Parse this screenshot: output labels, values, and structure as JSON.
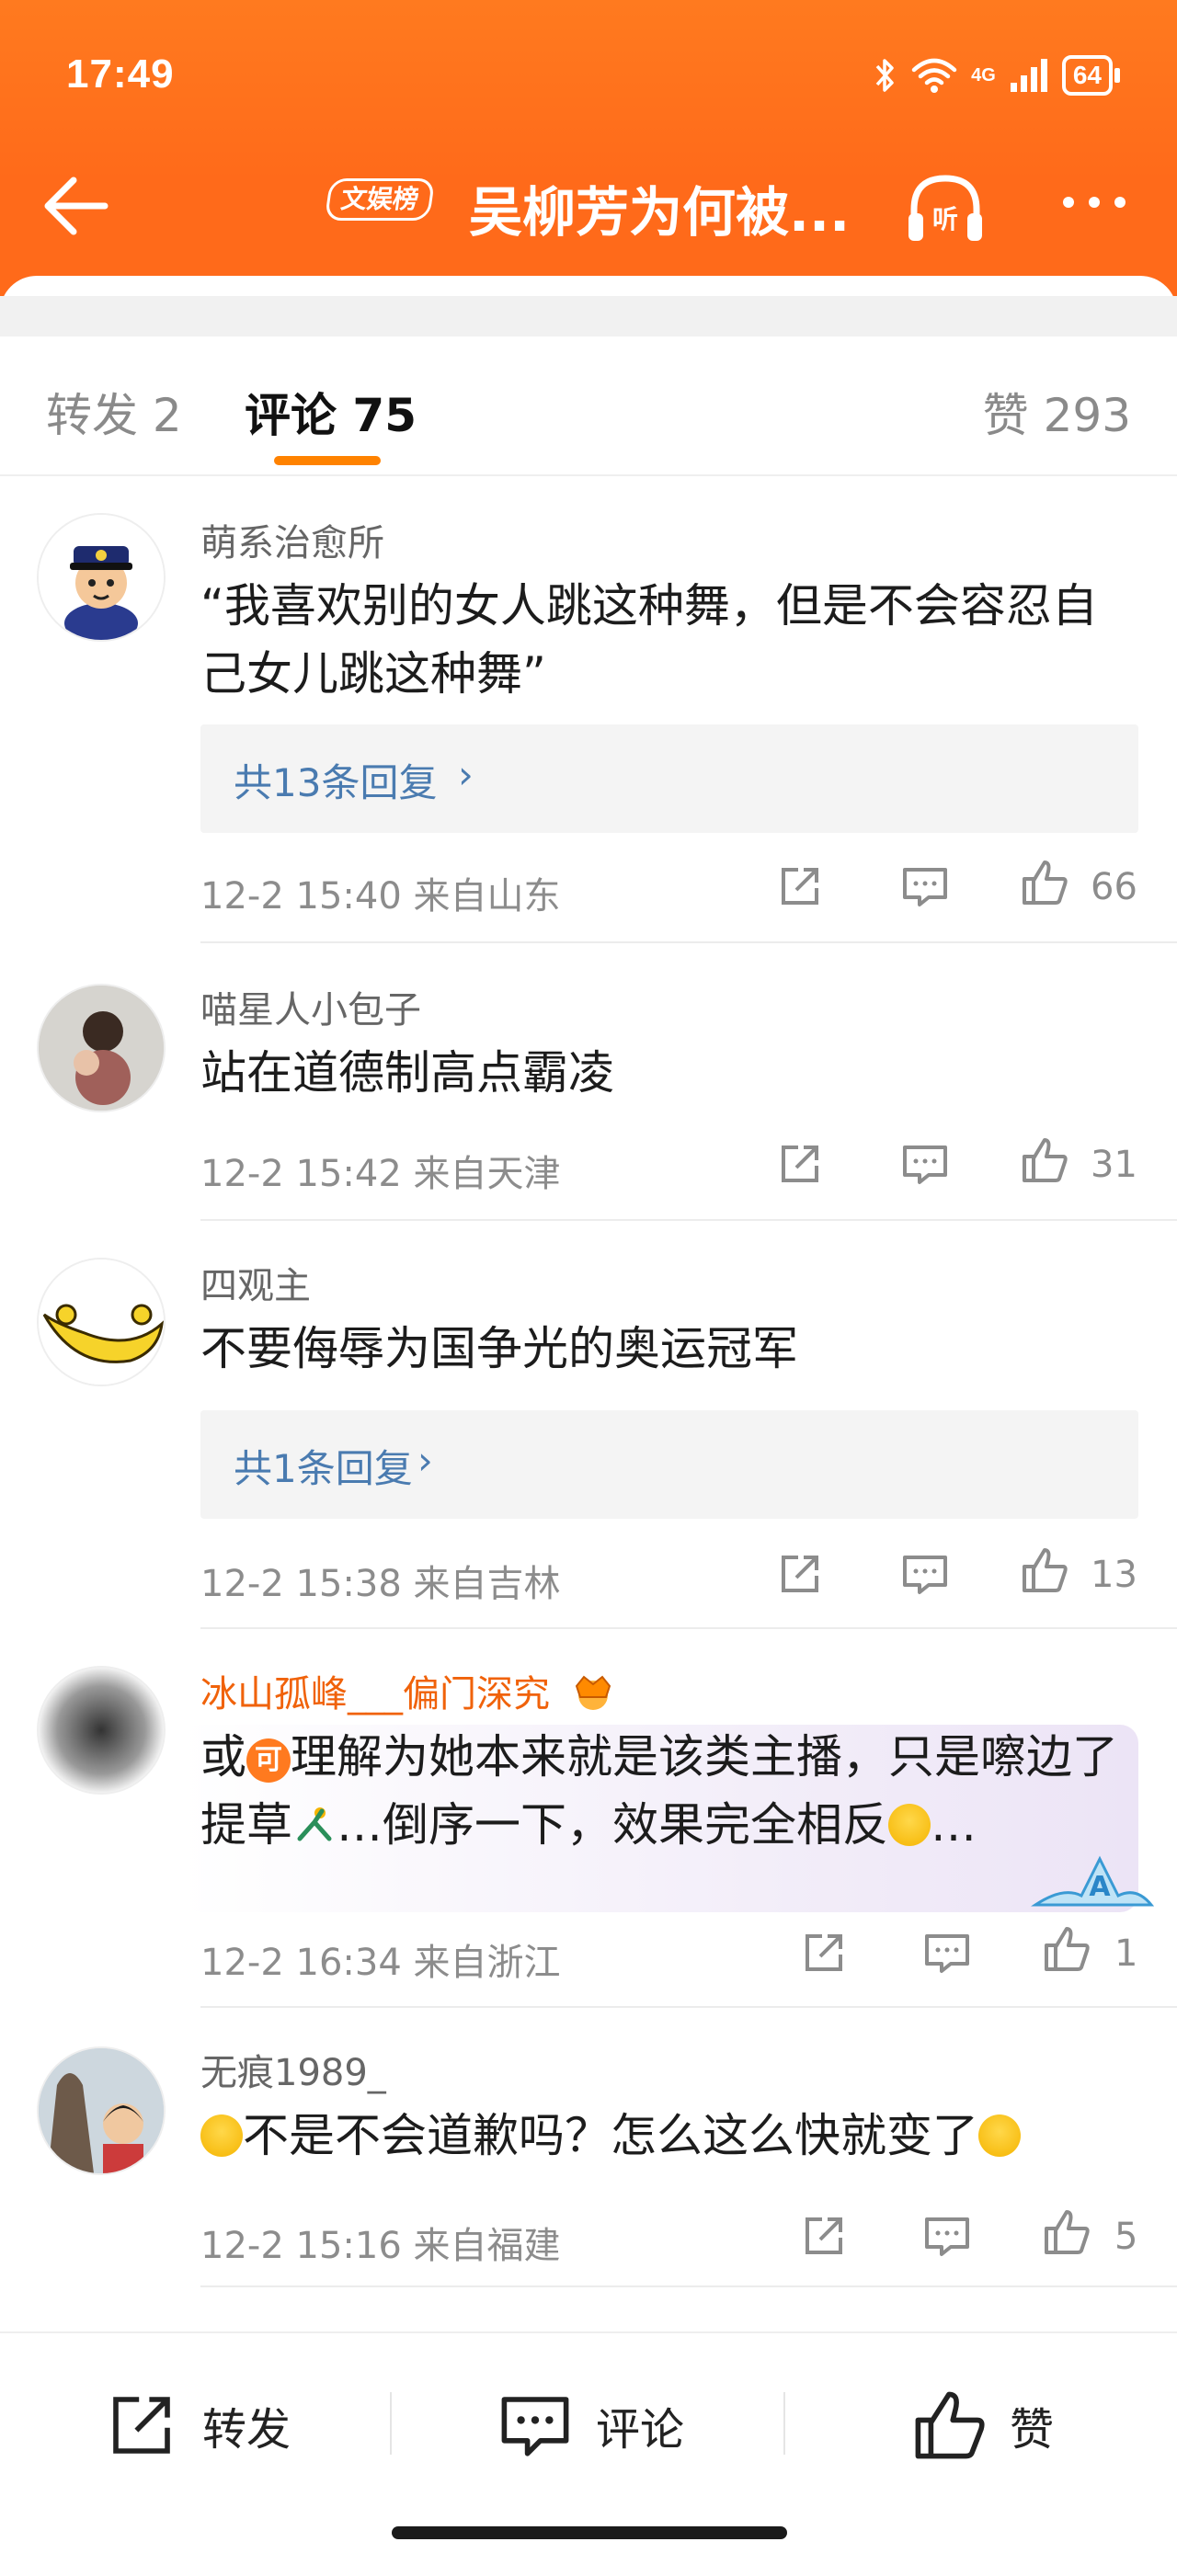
{
  "status_bar": {
    "time": "17:49",
    "network": "4G",
    "battery": "64"
  },
  "nav": {
    "topic_tag": "文娱榜",
    "title": "吴柳芳为何被..."
  },
  "tabs": {
    "repost": "转发 2",
    "comment": "评论 75",
    "likes": "赞 293"
  },
  "comments": [
    {
      "user": "萌系治愈所",
      "text": "“我喜欢别的女人跳这种舞，但是不会容忍自己女儿跳这种舞”",
      "replies": "共13条回复",
      "meta": "12-2 15:40  来自山东",
      "likes": "66"
    },
    {
      "user": "喵星人小包子",
      "text": "站在道德制高点霸凌",
      "meta": "12-2 15:42  来自天津",
      "likes": "31"
    },
    {
      "user": "四观主",
      "text": "不要侮辱为国争光的奥运冠军",
      "replies": "共1条回复",
      "meta": "12-2 15:38  来自吉林",
      "likes": "13"
    },
    {
      "user": "冰山孤峰___偏门深究",
      "text_a": "或",
      "badge": "可",
      "text_b": "理解为她本来就是该类主播，只是嚓边了提草",
      "text_c": "…倒序一下，效果完全相反",
      "text_d": "…",
      "meta": "12-2 16:34  来自浙江",
      "likes": "1"
    },
    {
      "user": "无痕1989_",
      "text_a": "不是不会道歉吗？怎么这么快就变了",
      "meta": "12-2 15:16  来自福建",
      "likes": "5"
    }
  ],
  "reply_arrow": "›",
  "bottom_bar": {
    "repost": "转发",
    "comment": "评论",
    "like": "赞"
  },
  "colors": {
    "brand_orange": "#ff6a1a",
    "link_blue": "#4a7bb0",
    "vip_name": "#f0620a"
  },
  "icons": [
    "back-arrow-icon",
    "listen-icon",
    "more-icon",
    "share-icon",
    "comment-icon",
    "like-icon"
  ]
}
